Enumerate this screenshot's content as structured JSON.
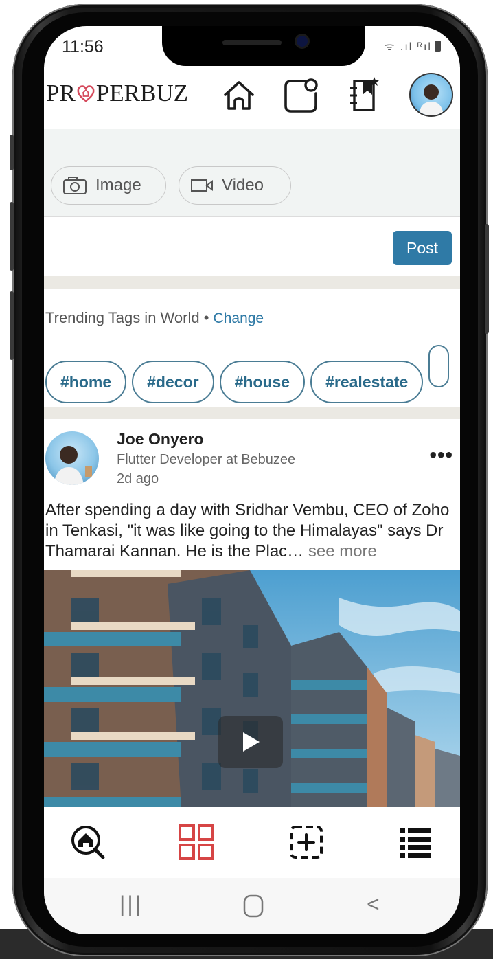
{
  "status_bar": {
    "time": "11:56",
    "signal": "ᯤ .ıl ᴿıl"
  },
  "header": {
    "logo_pre": "PR",
    "logo_post": "PERBUZ",
    "icons": [
      "home-outline-icon",
      "new-post-icon",
      "bookmark-star-icon"
    ]
  },
  "compose": {
    "image_label": "Image",
    "video_label": "Video",
    "post_label": "Post"
  },
  "trending": {
    "title": "Trending Tags in World",
    "dot": " • ",
    "change_label": "Change",
    "tags": [
      "#home",
      "#decor",
      "#house",
      "#realestate"
    ]
  },
  "post": {
    "author": "Joe Onyero",
    "role": "Flutter Developer at Bebuzee",
    "time": "2d ago",
    "more_icon": "•••",
    "text": "After spending a day with Sridhar Vembu, CEO of Zoho in Tenkasi, \"it was like going to the Himalayas\" says Dr Thamarai Kannan. He is the Plac…",
    "see_more": " see more"
  },
  "bottom_nav": [
    "search-home-icon",
    "grid-icon",
    "add-square-icon",
    "list-icon"
  ],
  "system_nav": {
    "recent": "|||",
    "home": "○",
    "back": "<"
  },
  "colors": {
    "accent": "#2f7aa6",
    "brand_red": "#d54a5c",
    "grid_red": "#d64545"
  }
}
